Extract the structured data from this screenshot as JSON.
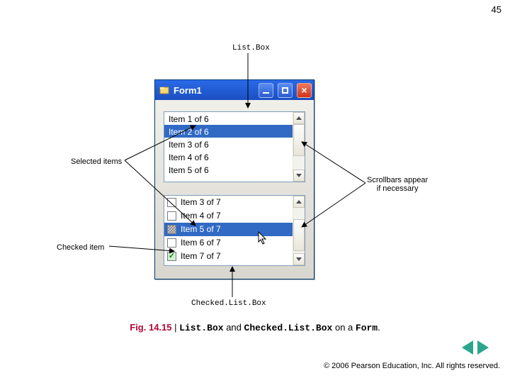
{
  "page_number": "45",
  "labels": {
    "listbox": "List.Box",
    "selected_items": "Selected items",
    "scrollbars": "Scrollbars appear\nif necessary",
    "checked_item": "Checked item",
    "checkedlistbox": "Checked.List.Box"
  },
  "window": {
    "title": "Form1"
  },
  "listbox": {
    "items": [
      "Item 1 of 6",
      "Item 2 of 6",
      "Item 3 of 6",
      "Item 4 of 6",
      "Item 5 of 6"
    ],
    "selected_index": 1
  },
  "checkedlistbox": {
    "items": [
      {
        "label": "Item 3 of 7",
        "checked": false,
        "selected": false,
        "partial": false
      },
      {
        "label": "Item 4 of 7",
        "checked": false,
        "selected": false,
        "partial": false
      },
      {
        "label": "Item 5 of 7",
        "checked": false,
        "selected": true,
        "partial": true
      },
      {
        "label": "Item 6 of 7",
        "checked": false,
        "selected": false,
        "partial": false
      },
      {
        "label": "Item 7 of 7",
        "checked": true,
        "selected": false,
        "partial": false
      }
    ]
  },
  "caption": {
    "fig": "Fig. 14.15",
    "sep": "|",
    "t1": "List.Box",
    "t2": "and",
    "t3": "Checked.List.Box",
    "t4": "on a",
    "t5": "Form",
    "dot": "."
  },
  "copyright": "© 2006 Pearson Education, Inc.  All rights reserved."
}
